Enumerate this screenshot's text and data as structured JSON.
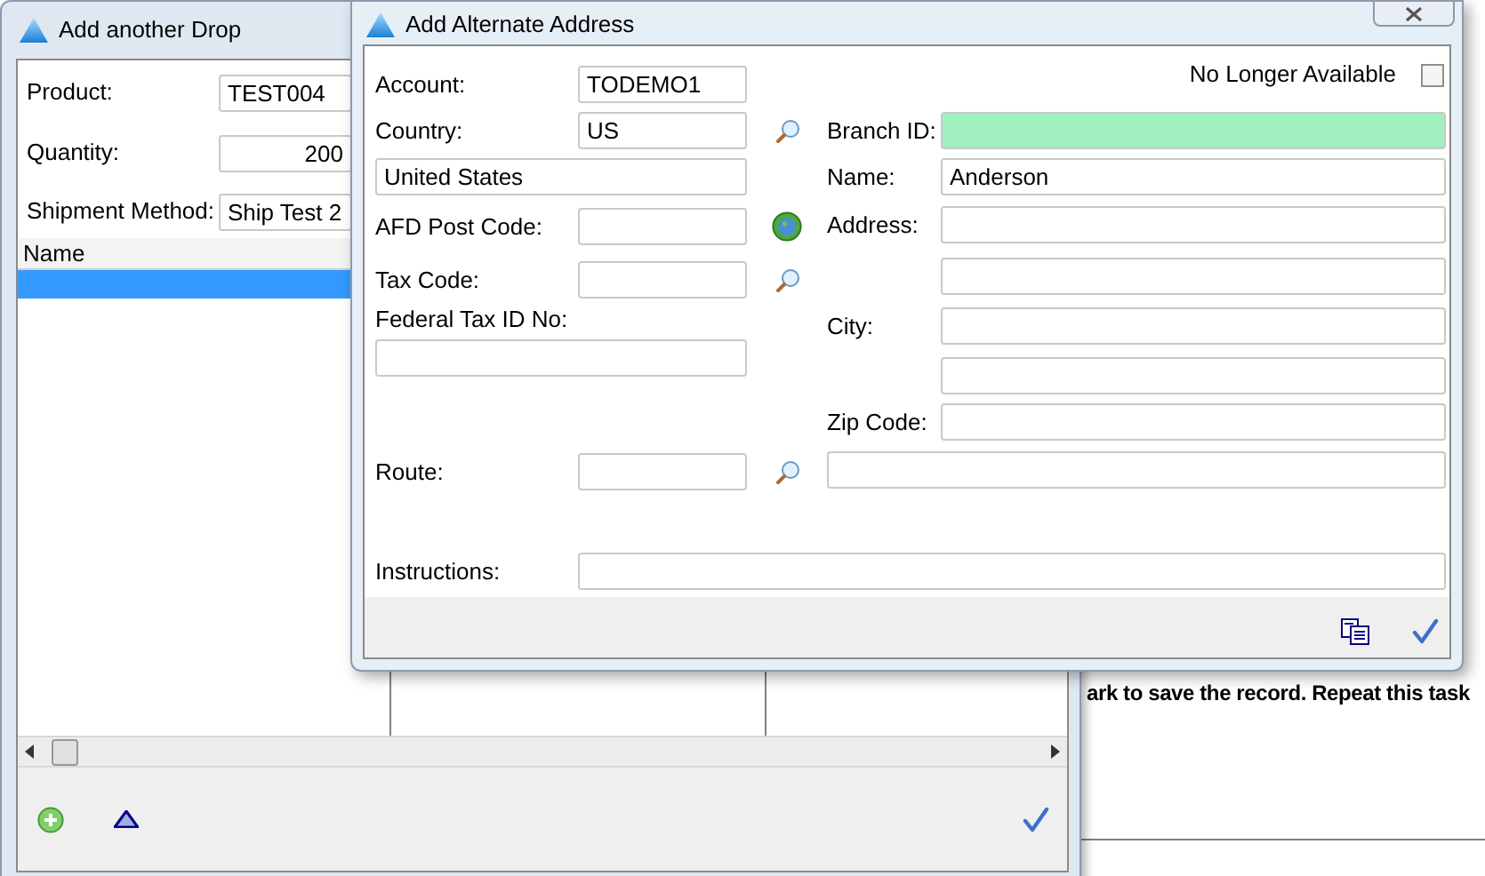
{
  "background_page": {
    "text": "ark to save the record. Repeat this task"
  },
  "drop_window": {
    "title": "Add another Drop",
    "fields": [
      {
        "kind": "text",
        "label": "Product:",
        "value": "TEST004"
      },
      {
        "kind": "number",
        "label": "Quantity:",
        "value": "200"
      },
      {
        "kind": "text",
        "label": "Shipment Method:",
        "value": "Ship Test 2"
      }
    ],
    "table": {
      "columns": [
        "Name"
      ],
      "rows": [
        {
          "selected": true
        }
      ]
    }
  },
  "address_window": {
    "title": "Add Alternate Address",
    "no_longer_available": {
      "label": "No Longer Available",
      "checked": false
    },
    "left_rows": [
      {
        "kind": "field",
        "label": "Account:",
        "value": "TODEMO1"
      },
      {
        "kind": "field",
        "label": "Country:",
        "value": "US",
        "button": {
          "kind": "lookup"
        }
      },
      {
        "kind": "wide",
        "value": "United States"
      },
      {
        "kind": "field",
        "label": "AFD Post Code:",
        "button": {
          "kind": "map"
        }
      },
      {
        "kind": "field",
        "label": "Tax Code:",
        "button": {
          "kind": "lookup"
        }
      },
      {
        "kind": "label",
        "label": "Federal Tax ID No:"
      },
      {
        "kind": "wide"
      },
      {
        "kind": "field",
        "label": "Route:",
        "button": {
          "kind": "lookup"
        }
      }
    ],
    "right_rows": [
      {
        "kind": "field",
        "label": "Branch ID:",
        "highlighted": true
      },
      {
        "kind": "field",
        "label": "Name:",
        "value": "Anderson",
        "highlighted": false
      },
      {
        "kind": "field",
        "label": "Address:",
        "highlighted": false
      },
      {
        "kind": "field",
        "highlighted": false
      },
      {
        "kind": "field",
        "label": "City:",
        "highlighted": false
      },
      {
        "kind": "field",
        "highlighted": false
      },
      {
        "kind": "field",
        "label": "Zip Code:",
        "highlighted": false
      },
      {
        "kind": "wide",
        "highlighted": false
      }
    ],
    "instructions": {
      "label": "Instructions:"
    }
  }
}
